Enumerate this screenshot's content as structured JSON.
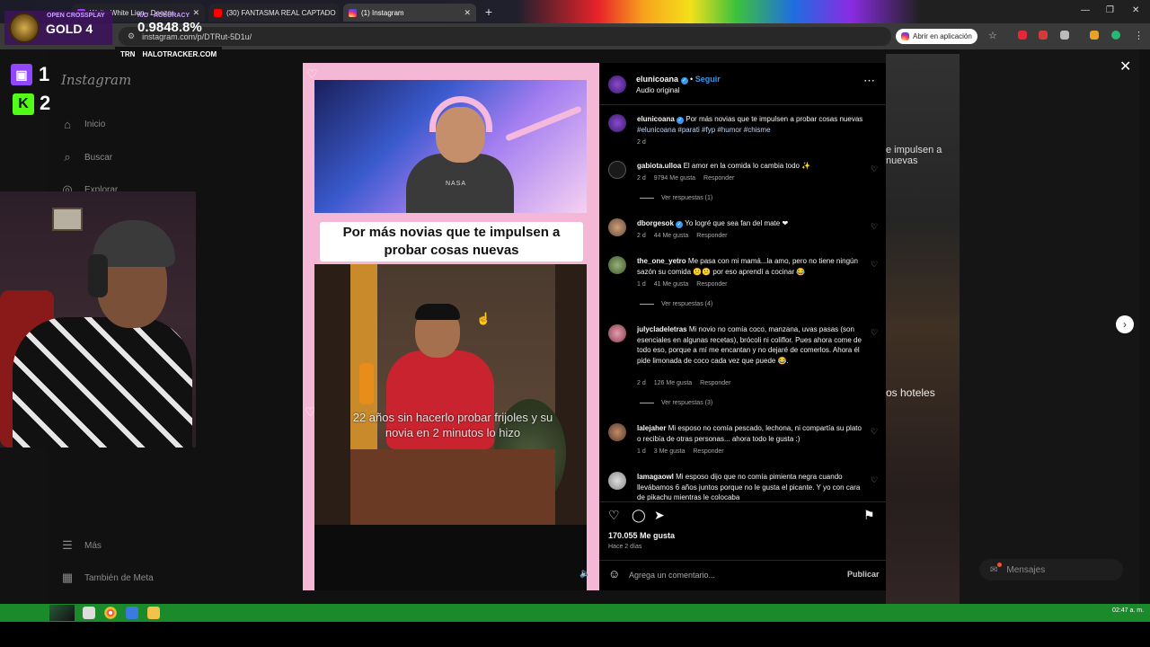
{
  "browser": {
    "tabs": [
      {
        "label": "Wait - White Lion - Deezer"
      },
      {
        "label": "(30) FANTASMA REAL CAPTADO"
      },
      {
        "label": "(1) Instagram"
      }
    ],
    "url": "instagram.com/p/DTRut-5D1u/",
    "open_app_label": "Abrir en aplicación"
  },
  "overlay": {
    "rank": "GOLD 4",
    "block_label": "OPEN CROSSPLAY",
    "kd_label": "K/D · ACCURACY",
    "kd_value": "0.9848.8%",
    "tracker_brand": "TRN",
    "tracker_site": "HALOTRACKER.COM",
    "twitch_count": "1",
    "kick_count": "2"
  },
  "instagram_nav": {
    "logo": "Instagram",
    "items": [
      {
        "label": "Inicio",
        "icon": "home-icon"
      },
      {
        "label": "Buscar",
        "icon": "search-icon"
      },
      {
        "label": "Explorar",
        "icon": "compass-icon"
      },
      {
        "label": "Más",
        "icon": "menu-icon"
      },
      {
        "label": "También de Meta",
        "icon": "meta-icon"
      }
    ]
  },
  "background_feed": {
    "text1": "e impulsen a nuevas",
    "text2": "os hoteles",
    "messages_label": "Mensajes"
  },
  "video": {
    "caption": "Por más novias que te impulsen a probar cosas nuevas",
    "shirt_text": "NASA",
    "subtitle": "22 años sin hacerlo probar frijoles y su novia en 2 minutos lo hizo"
  },
  "post": {
    "author": "elunicoana",
    "follow_label": "Seguir",
    "audio_label": "Audio original",
    "caption_text": "Por más novias que te impulsen a probar cosas nuevas",
    "hashtags": "#elunicoana #parati #fyp #humor #chisme",
    "caption_age": "2 d",
    "likes": "170.055 Me gusta",
    "posted_ago": "Hace 2 días",
    "comment_placeholder": "Agrega un comentario...",
    "publish_label": "Publicar",
    "reply_label": "Responder"
  },
  "comments": [
    {
      "user": "gabiota.ulloa",
      "text": "El amor en la comida lo cambia todo ✨",
      "age": "2 d",
      "likes": "9794 Me gusta",
      "replies": "Ver respuestas (1)"
    },
    {
      "user": "dborgesok",
      "text": "Yo logré que sea fan del mate ❤",
      "age": "2 d",
      "likes": "44 Me gusta",
      "replies": ""
    },
    {
      "user": "the_one_yetro",
      "text": "Me pasa con mi mamá...la amo, pero no tiene ningún sazón su comida 😕😕 por eso aprendí a cocinar 😂",
      "age": "1 d",
      "likes": "41 Me gusta",
      "replies": "Ver respuestas (4)"
    },
    {
      "user": "julycladeletras",
      "text": "Mi novio no comía coco, manzana, uvas pasas (son esenciales en algunas recetas), brócoli ni coliflor. Pues ahora come de todo eso, porque a mí me encantan y no dejaré de comerlos. Ahora él pide limonada de coco cada vez que puede 😂.",
      "age": "2 d",
      "likes": "126 Me gusta",
      "replies": "Ver respuestas (3)"
    },
    {
      "user": "lalejaher",
      "text": "Mi esposo no comía pescado, lechona, ni compartía su plato o recibía de otras personas... ahora todo le gusta :)",
      "age": "1 d",
      "likes": "3 Me gusta",
      "replies": ""
    },
    {
      "user": "lamagaowl",
      "text": "Mi esposo dijo que no comía pimienta negra cuando llevábamos 6 años juntos porque no le gusta el picante. Y yo con cara de pikachu mientras le colocaba",
      "age": "",
      "likes": "",
      "replies": ""
    }
  ],
  "taskbar": {
    "clock": "02:47 a. m."
  },
  "colors": {
    "instagram_blue": "#3897f0",
    "video_frame_pink": "#f4b7d6",
    "twitch": "#9146ff",
    "kick": "#53fc18"
  }
}
